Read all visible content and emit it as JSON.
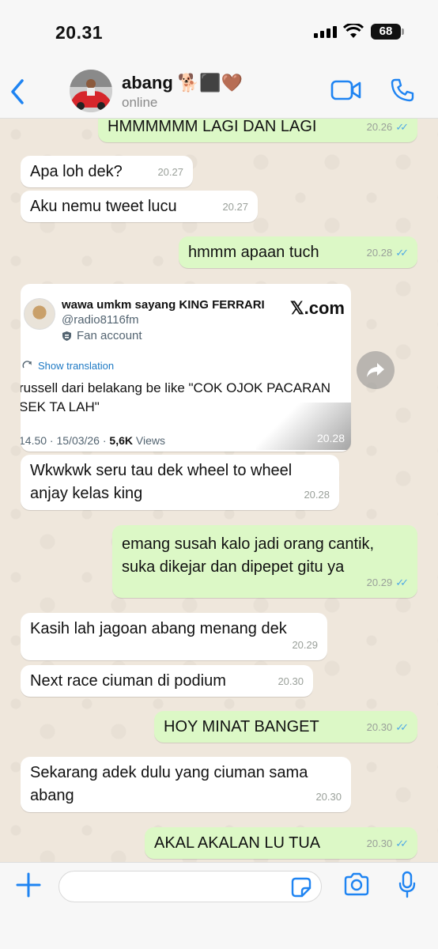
{
  "status": {
    "time": "20.31",
    "battery": "68"
  },
  "header": {
    "name": "abang 🐕‍⬛🤎",
    "status": "online"
  },
  "messages": [
    {
      "text": "HMMMMMM LAGI DAN LAGI",
      "time": "20.26",
      "dir": "out"
    },
    {
      "text": "Apa loh dek?",
      "time": "20.27",
      "dir": "in"
    },
    {
      "text": "Aku nemu tweet lucu",
      "time": "20.27",
      "dir": "in"
    },
    {
      "text": "hmmm apaan tuch",
      "time": "20.28",
      "dir": "out"
    },
    {
      "text": "Wkwkwk seru tau dek wheel to wheel\nanjay kelas king",
      "time": "20.28",
      "dir": "in"
    },
    {
      "text": "emang susah kalo jadi orang cantik,\nsuka dikejar dan dipepet gitu ya",
      "time": "20.29",
      "dir": "out"
    },
    {
      "text": "Kasih lah jagoan abang menang dek",
      "time": "20.29",
      "dir": "in"
    },
    {
      "text": "Next race ciuman di podium",
      "time": "20.30",
      "dir": "in"
    },
    {
      "text": "HOY MINAT BANGET",
      "time": "20.30",
      "dir": "out"
    },
    {
      "text": "Sekarang adek dulu yang ciuman  sama\nabang",
      "time": "20.30",
      "dir": "in"
    },
    {
      "text": "AKAL AKALAN LU TUA",
      "time": "20.30",
      "dir": "out"
    }
  ],
  "tweet": {
    "name": "wawa umkm sayang KING FERRARI",
    "handle": "@radio8116fm",
    "badge": "Fan account",
    "domain": "𝕏.com",
    "translate": "Show translation",
    "body": "russell dari belakang be like \"COK OJOK PACARAN SEK TA LAH\"",
    "posted": "14.50 · 15/03/26 · ",
    "views": "5,6K",
    "views_label": " Views",
    "time": "20.28"
  },
  "colors": {
    "accent": "#1f84f2",
    "outgoing": "#dcf8c6",
    "incoming": "#ffffff",
    "read_ticks": "#4fa9e6"
  },
  "icons": [
    "back-chevron-icon",
    "video-call-icon",
    "phone-icon",
    "plus-icon",
    "sticker-icon",
    "camera-icon",
    "microphone-icon",
    "forward-icon",
    "translate-icon",
    "fan-account-icon"
  ]
}
